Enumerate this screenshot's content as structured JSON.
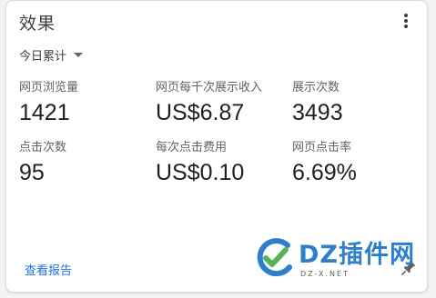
{
  "card": {
    "title": "效果",
    "date_range": "今日累计",
    "report_link": "查看报告"
  },
  "metrics": [
    {
      "label": "网页浏览量",
      "value": "1421"
    },
    {
      "label": "网页每千次展示收入",
      "value": "US$6.87"
    },
    {
      "label": "展示次数",
      "value": "3493"
    },
    {
      "label": "点击次数",
      "value": "95"
    },
    {
      "label": "每次点击费用",
      "value": "US$0.10"
    },
    {
      "label": "网页点击率",
      "value": "6.69%"
    }
  ],
  "watermark": {
    "text": "DZ插件网",
    "sub": "DZ-X.NET"
  },
  "icons": {
    "more": "more-vert-icon",
    "dropdown": "caret-down-icon",
    "pin": "pin-icon"
  },
  "colors": {
    "link": "#1a73e8",
    "watermark_blue": "#2478c9",
    "watermark_green": "#4caf50"
  }
}
